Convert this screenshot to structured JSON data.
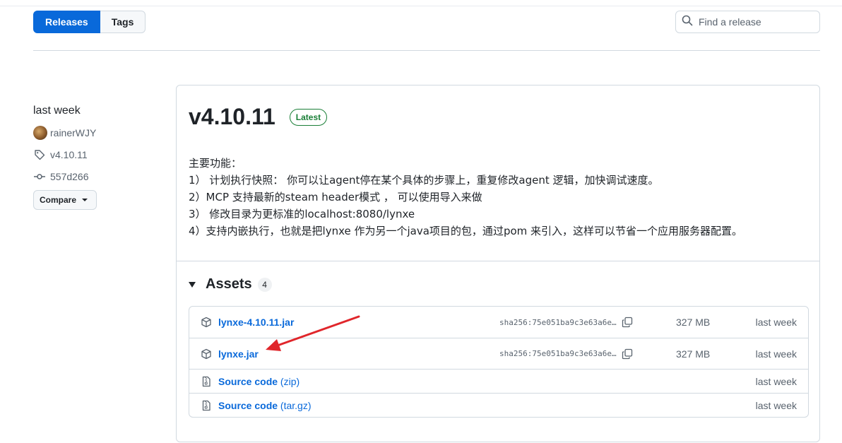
{
  "tabs": {
    "releases": "Releases",
    "tags": "Tags"
  },
  "search": {
    "placeholder": "Find a release"
  },
  "sidebar": {
    "date": "last week",
    "author": "rainerWJY",
    "tag": "v4.10.11",
    "commit": "557d266",
    "compare_label": "Compare"
  },
  "release": {
    "title": "v4.10.11",
    "badge": "Latest",
    "notes": [
      "主要功能：",
      "1） 计划执行快照： 你可以让agent停在某个具体的步骤上，重复修改agent 逻辑，加快调试速度。",
      "2）MCP 支持最新的steam header模式 ， 可以使用导入来做",
      "3） 修改目录为更标准的localhost:8080/lynxe",
      "4）支持内嵌执行，也就是把lynxe 作为另一个java项目的包，通过pom 来引入，这样可以节省一个应用服务器配置。"
    ]
  },
  "assets": {
    "title": "Assets",
    "count": "4",
    "items": [
      {
        "name": "lynxe-4.10.11.jar",
        "ext": "",
        "sha": "sha256:75e051ba9c3e63a6e…",
        "size": "327 MB",
        "when": "last week",
        "icon": "package-icon"
      },
      {
        "name": "lynxe.jar",
        "ext": "",
        "sha": "sha256:75e051ba9c3e63a6e…",
        "size": "327 MB",
        "when": "last week",
        "icon": "package-icon"
      },
      {
        "name": "Source code",
        "ext": " (zip)",
        "sha": "",
        "size": "",
        "when": "last week",
        "icon": "file-zip-icon"
      },
      {
        "name": "Source code",
        "ext": " (tar.gz)",
        "sha": "",
        "size": "",
        "when": "last week",
        "icon": "file-zip-icon"
      }
    ]
  },
  "colors": {
    "accent": "#0969da",
    "latest": "#1a7f37",
    "annotation": "#e0262b"
  }
}
